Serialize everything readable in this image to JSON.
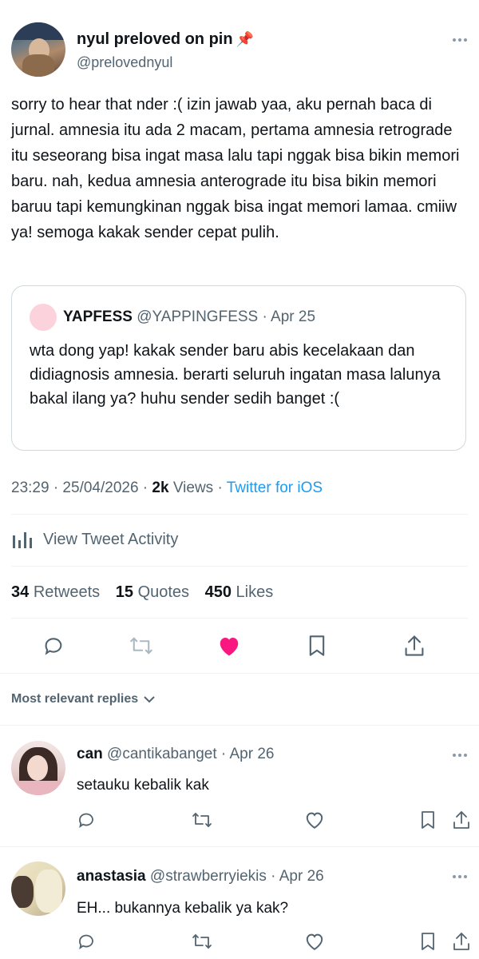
{
  "tweet": {
    "display_name": "nyul preloved on pin",
    "pin_emoji": "📌",
    "handle": "@prelovednyul",
    "text": "sorry to hear that nder :( izin jawab yaa, aku pernah baca di jurnal. amnesia itu ada 2 macam, pertama amnesia retrograde itu seseorang bisa ingat masa lalu tapi nggak bisa bikin memori baru. nah, kedua amnesia anterograde itu bisa bikin memori baruu tapi kemungkinan nggak bisa ingat memori lamaa. cmiiw ya! semoga kakak sender cepat pulih.",
    "quote": {
      "name": "YAPFESS",
      "handle": "@YAPPINGFESS",
      "date": "· Apr 25",
      "text": "wta dong yap! kakak sender baru abis kecelakaan dan didiagnosis amnesia. berarti seluruh ingatan masa lalunya bakal ilang ya? huhu sender sedih banget :("
    },
    "meta": {
      "time_date": "23:29 · 25/04/2026 ·",
      "views_count": "2k",
      "views_label": "Views",
      "sep": "·",
      "client": "Twitter for iOS"
    },
    "activity_label": "View Tweet Activity",
    "stats": {
      "retweets_count": "34",
      "retweets_label": "Retweets",
      "quotes_count": "15",
      "quotes_label": "Quotes",
      "likes_count": "450",
      "likes_label": "Likes"
    },
    "like_color": "#f91880"
  },
  "replies_header": "Most relevant replies",
  "replies": [
    {
      "name": "can",
      "handle": "@cantikabanget",
      "date": "· Apr 26",
      "text": "setauku kebalik kak"
    },
    {
      "name": "anastasia",
      "handle": "@strawberryiekis",
      "date": "· Apr 26",
      "text": "EH... bukannya kebalik ya kak?"
    }
  ]
}
